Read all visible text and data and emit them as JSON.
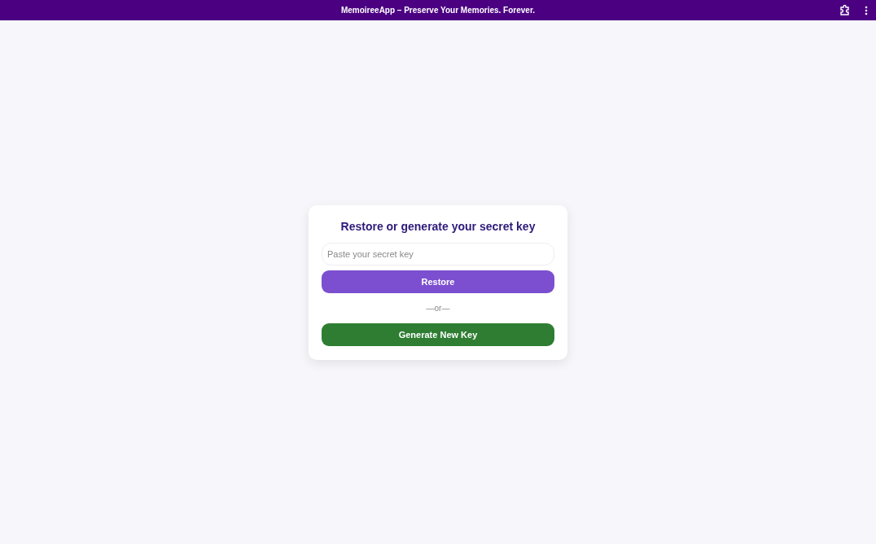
{
  "window": {
    "title": "MemoireeApp – Preserve Your Memories. Forever."
  },
  "card": {
    "heading": "Restore or generate your secret key",
    "key_field": {
      "placeholder": "Paste your secret key"
    },
    "restore_button": "Restore",
    "divider_text": "—or—",
    "generate_button": "Generate New Key"
  }
}
